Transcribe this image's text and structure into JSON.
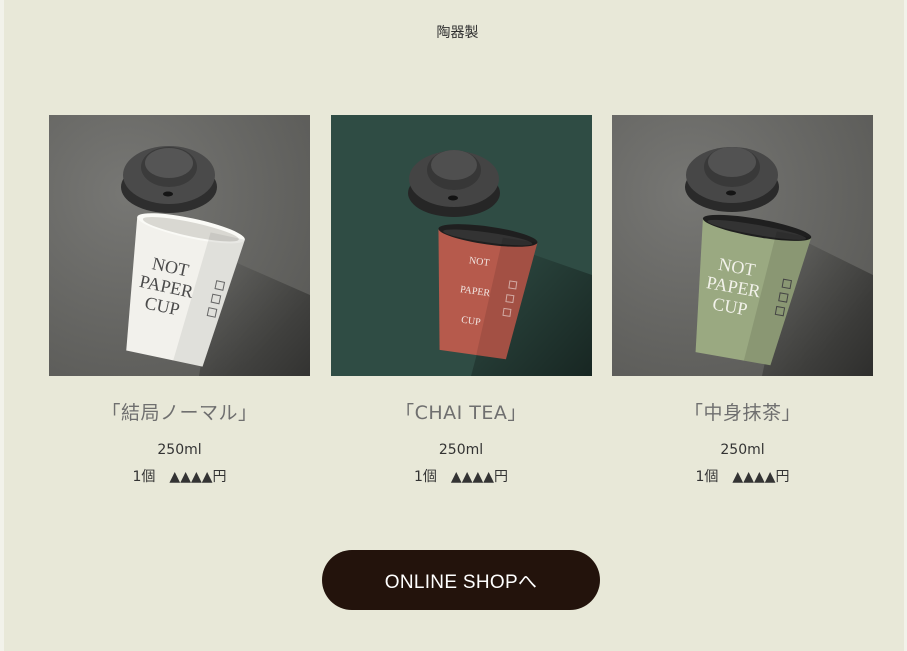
{
  "material_label": "陶器製",
  "products": [
    {
      "name": "「結局ノーマル」",
      "volume": "250ml",
      "quantity": "1個",
      "price": "▲▲▲▲円",
      "cup_print": [
        "NOT",
        "PAPER",
        "CUP"
      ],
      "colors": {
        "background": "#6d6d6a",
        "cup": "#f0efea",
        "text": "#4a4a4a"
      }
    },
    {
      "name": "「CHAI TEA」",
      "volume": "250ml",
      "quantity": "1個",
      "price": "▲▲▲▲円",
      "cup_print": [
        "NOT",
        "PAPER",
        "CUP"
      ],
      "colors": {
        "background": "#2d4a42",
        "cup": "#b65a4c",
        "text": "#f1e6e2"
      }
    },
    {
      "name": "「中身抹茶」",
      "volume": "250ml",
      "quantity": "1個",
      "price": "▲▲▲▲円",
      "cup_print": [
        "NOT",
        "PAPER",
        "CUP"
      ],
      "colors": {
        "background": "#6d6d6a",
        "cup": "#9aa981",
        "text": "#f2f2ea"
      }
    }
  ],
  "online_shop_label": "ONLINE SHOPへ",
  "colors": {
    "page_background": "#e8e8d8",
    "button_background": "#23130c",
    "button_text": "#ffffff"
  }
}
